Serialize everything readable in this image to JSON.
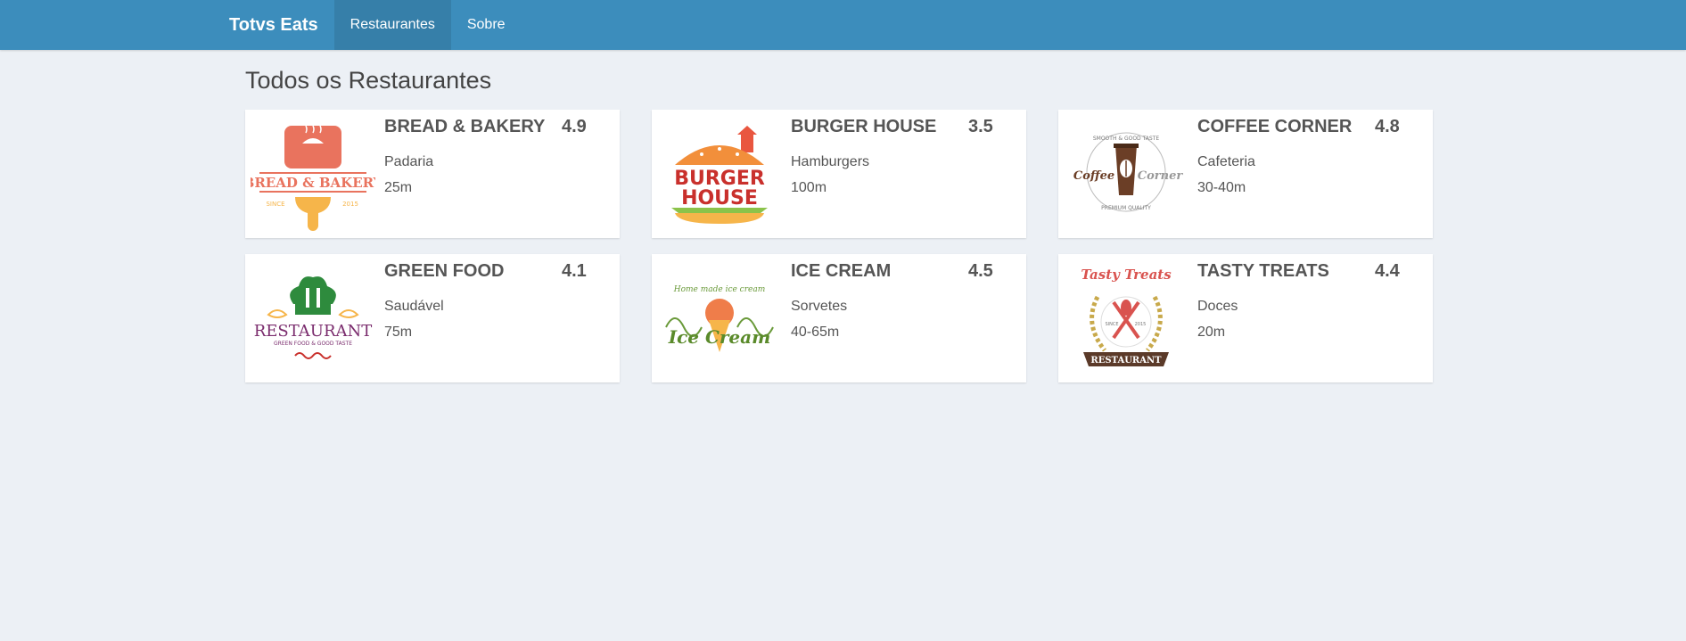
{
  "navbar": {
    "brand": "Totvs Eats",
    "links": [
      {
        "label": "Restaurantes",
        "active": true
      },
      {
        "label": "Sobre",
        "active": false
      }
    ],
    "color": "#3c8dbc",
    "active_color": "#367fa9"
  },
  "page": {
    "title": "Todos os Restaurantes",
    "background": "#ecf0f5"
  },
  "restaurants": [
    {
      "name": "BREAD & BAKERY",
      "rating": "4.9",
      "category": "Padaria",
      "delivery_time": "25m",
      "logo_icon": "bread-bakery-logo-icon",
      "logo_text": [
        "BREAD & BAKERY",
        "SINCE",
        "2015"
      ]
    },
    {
      "name": "BURGER HOUSE",
      "rating": "3.5",
      "category": "Hamburgers",
      "delivery_time": "100m",
      "logo_icon": "burger-house-logo-icon",
      "logo_text": [
        "BURGER",
        "HOUSE"
      ]
    },
    {
      "name": "COFFEE CORNER",
      "rating": "4.8",
      "category": "Cafeteria",
      "delivery_time": "30-40m",
      "logo_icon": "coffee-corner-logo-icon",
      "logo_text": [
        "SMOOTH & GOOD TASTE",
        "Coffee",
        "Corner",
        "PREMIUM QUALITY"
      ]
    },
    {
      "name": "GREEN FOOD",
      "rating": "4.1",
      "category": "Saudável",
      "delivery_time": "75m",
      "logo_icon": "green-food-logo-icon",
      "logo_text": [
        "RESTAURANT",
        "GREEN FOOD & GOOD TASTE"
      ]
    },
    {
      "name": "ICE CREAM",
      "rating": "4.5",
      "category": "Sorvetes",
      "delivery_time": "40-65m",
      "logo_icon": "ice-cream-logo-icon",
      "logo_text": [
        "Home made ice cream",
        "Ice Cream"
      ]
    },
    {
      "name": "TASTY TREATS",
      "rating": "4.4",
      "category": "Doces",
      "delivery_time": "20m",
      "logo_icon": "tasty-treats-logo-icon",
      "logo_text": [
        "Tasty Treats",
        "SINCE",
        "2015",
        "RESTAURANT"
      ]
    }
  ]
}
